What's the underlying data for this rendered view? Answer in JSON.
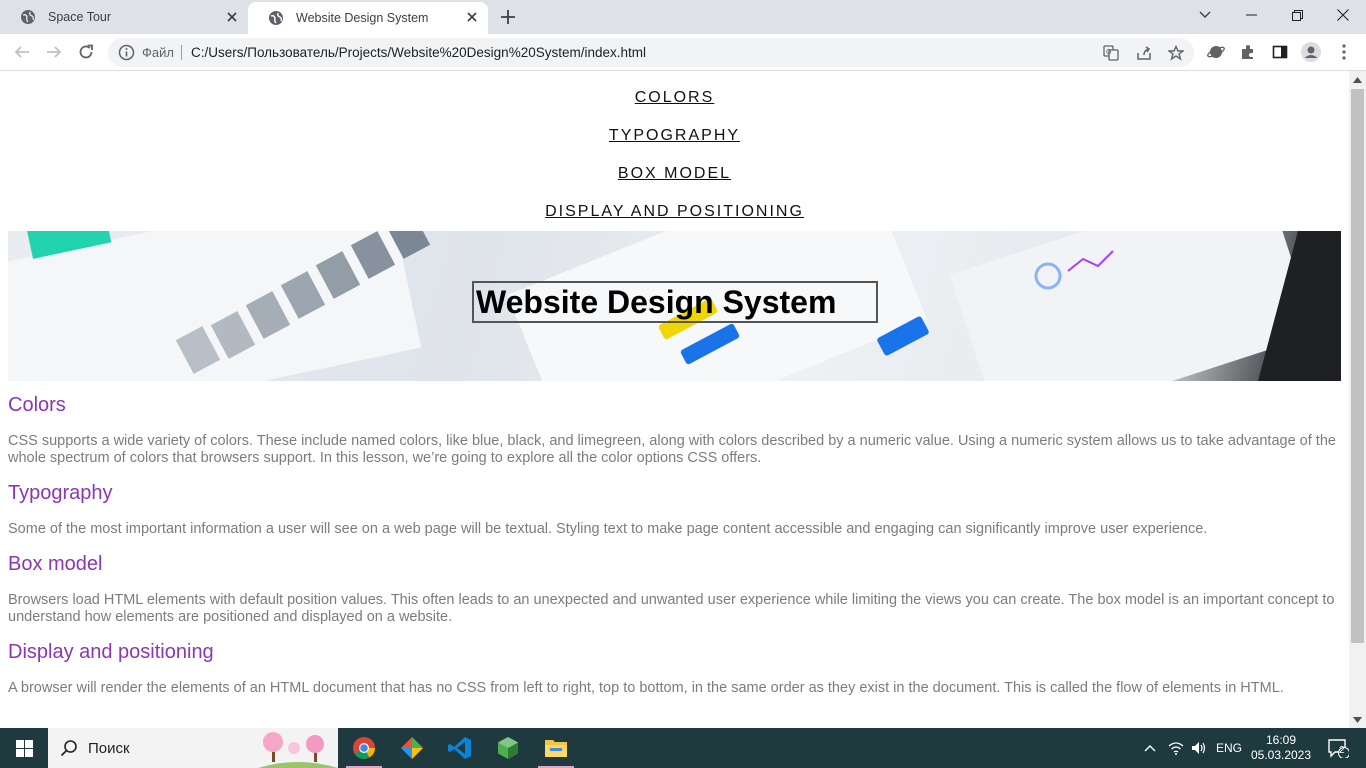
{
  "browser": {
    "tabs": [
      {
        "title": "Space Tour",
        "active": false
      },
      {
        "title": "Website Design System",
        "active": true
      }
    ],
    "address": {
      "scheme_label": "Файл",
      "url": "C:/Users/Пользователь/Projects/Website%20Design%20System/index.html"
    }
  },
  "page": {
    "nav": [
      "COLORS",
      "TYPOGRAPHY",
      "BOX MODEL",
      "DISPLAY AND POSITIONING"
    ],
    "hero_title": "Website Design System",
    "sections": [
      {
        "heading": "Colors",
        "text": "CSS supports a wide variety of colors. These include named colors, like blue, black, and limegreen, along with colors described by a numeric value. Using a numeric system allows us to take advantage of the whole spectrum of colors that browsers support. In this lesson, we’re going to explore all the color options CSS offers."
      },
      {
        "heading": "Typography",
        "text": "Some of the most important information a user will see on a web page will be textual. Styling text to make page content accessible and engaging can significantly improve user experience."
      },
      {
        "heading": "Box model",
        "text": "Browsers load HTML elements with default position values. This often leads to an unexpected and unwanted user experience while limiting the views you can create. The box model is an important concept to understand how elements are positioned and displayed on a website."
      },
      {
        "heading": "Display and positioning",
        "text": "A browser will render the elements of an HTML document that has no CSS from left to right, top to bottom, in the same order as they exist in the document. This is called the flow of elements in HTML."
      }
    ],
    "colors": {
      "heading": "#8a36b5",
      "body_text": "#7c7c7c",
      "nav_link": "#111111"
    }
  },
  "taskbar": {
    "search_placeholder": "Поиск",
    "language": "ENG",
    "time": "16:09",
    "date": "05.03.2023",
    "notifications": "2",
    "apps": [
      "chrome-icon",
      "git-kraken-icon",
      "vscode-icon",
      "box-icon",
      "file-explorer-icon"
    ]
  }
}
